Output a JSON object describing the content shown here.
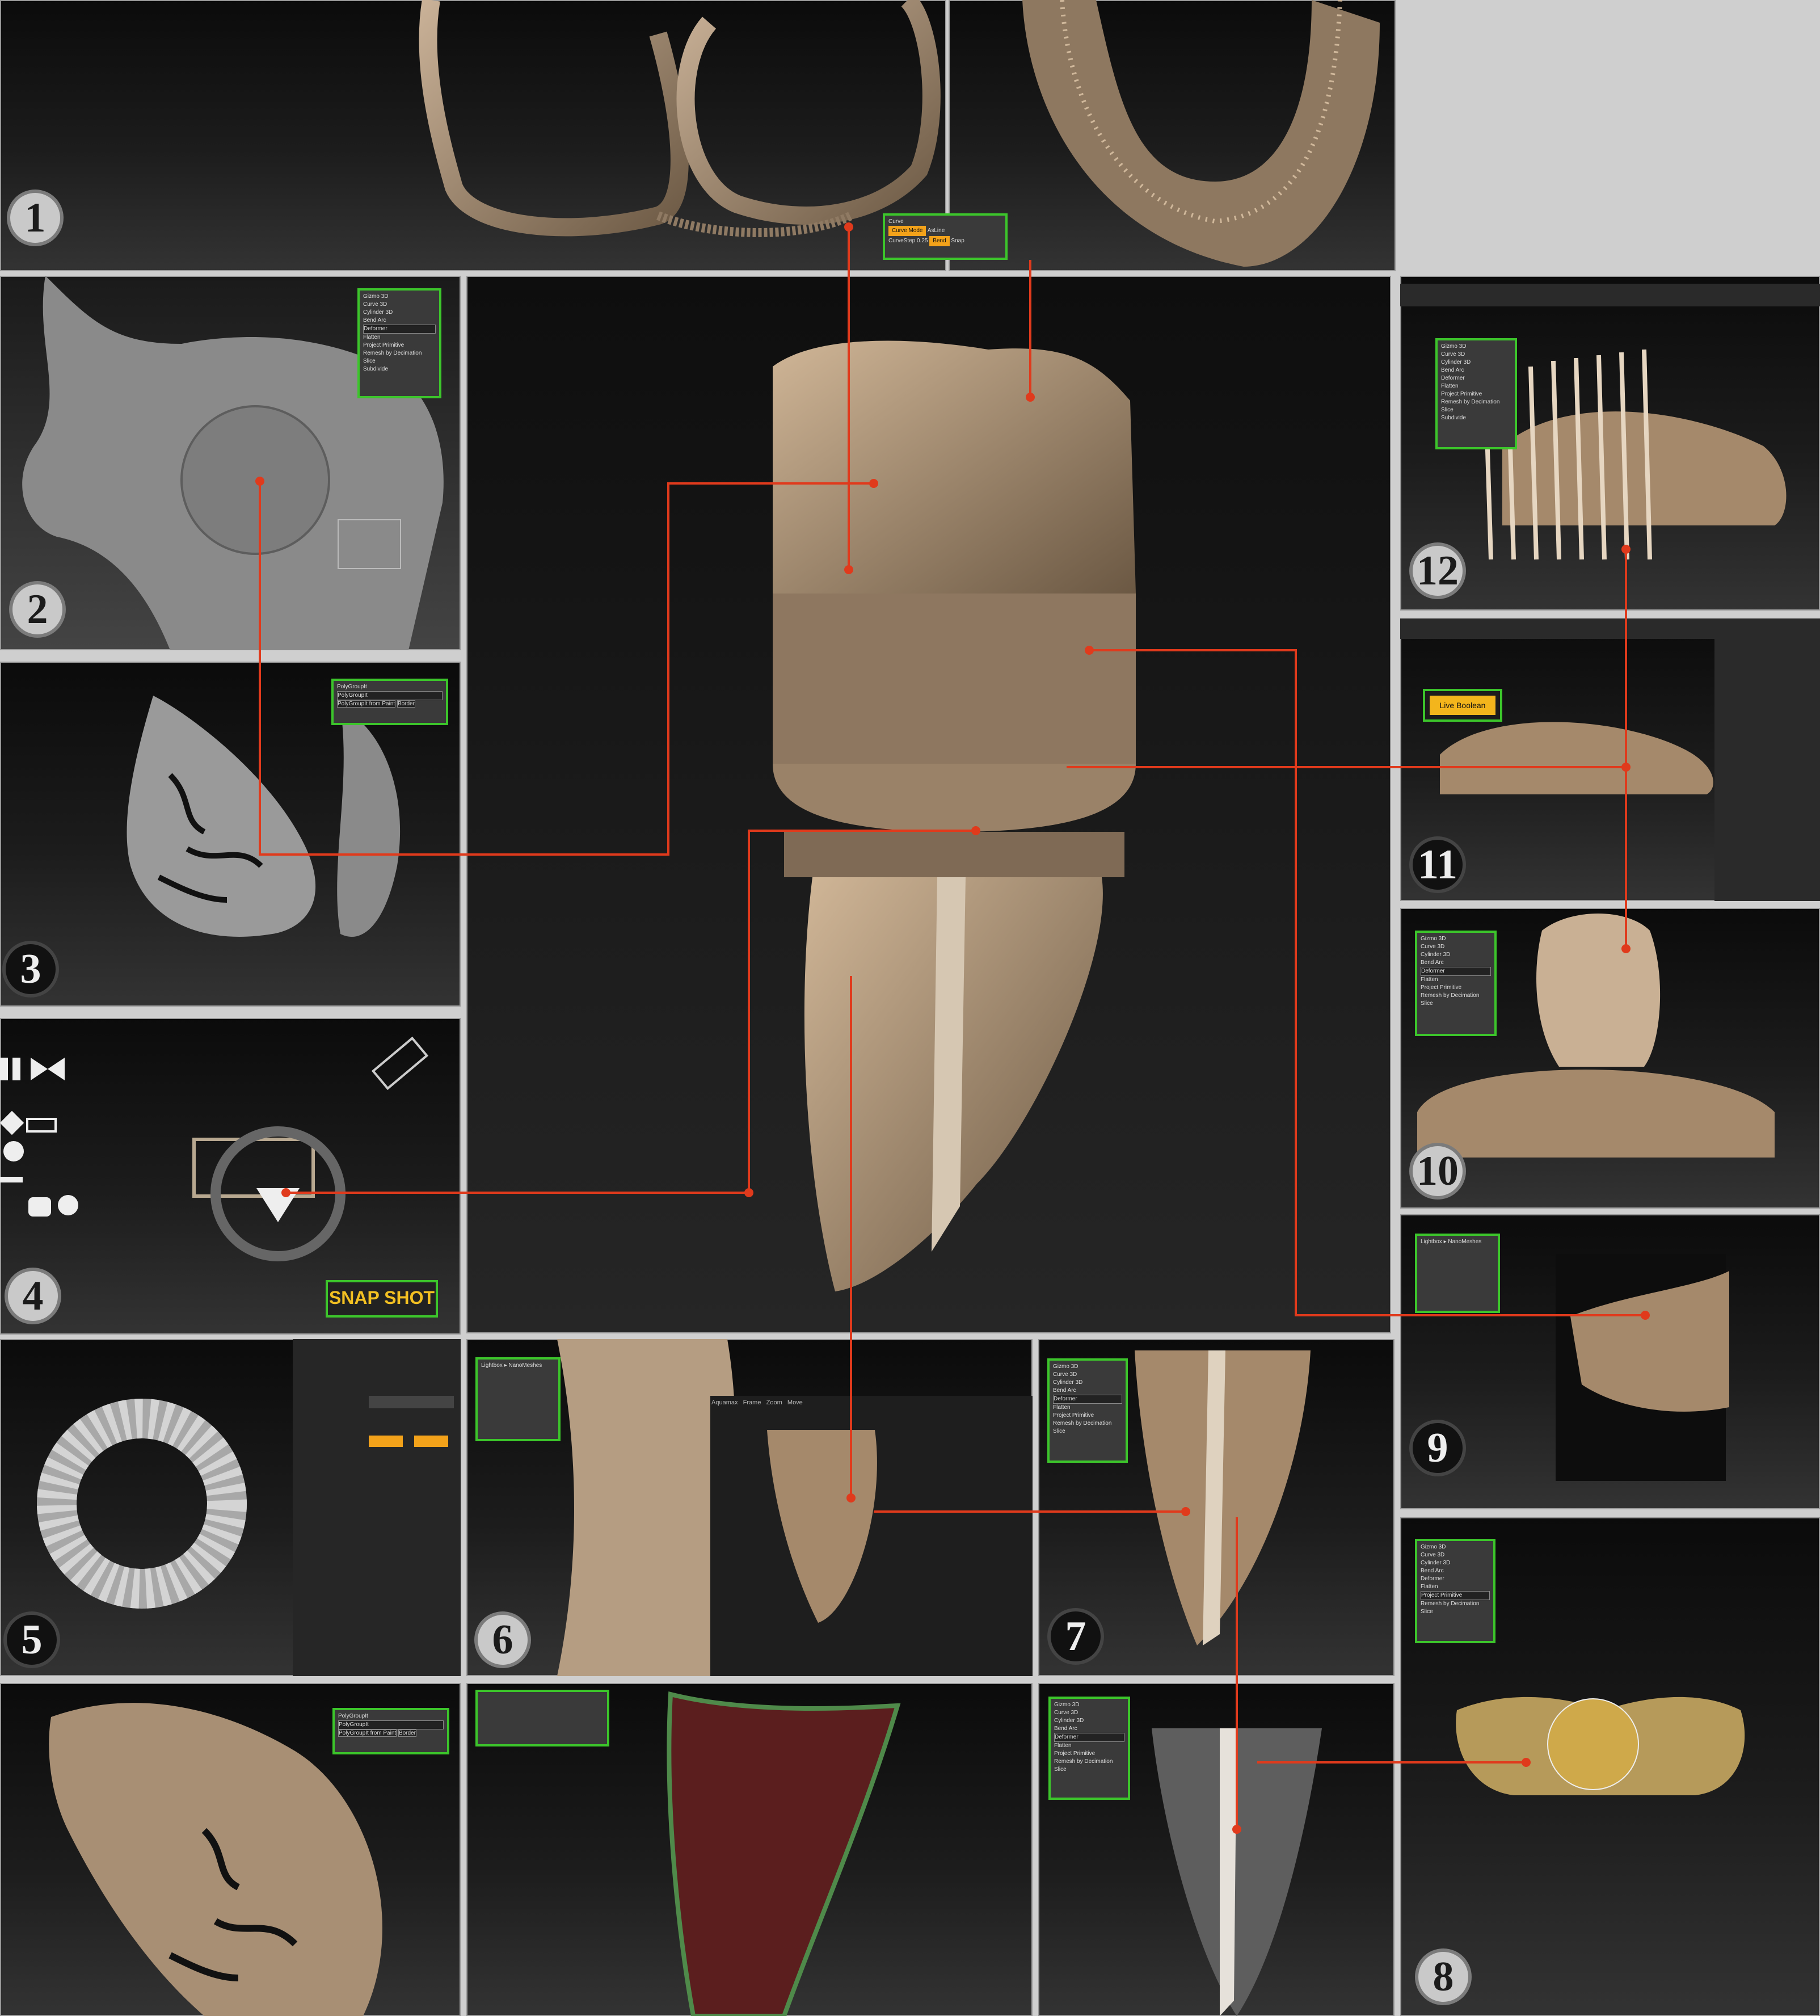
{
  "step_numbers": [
    "1",
    "2",
    "3",
    "4",
    "5",
    "6",
    "7",
    "8",
    "9",
    "10",
    "11",
    "12"
  ],
  "curve_menu": {
    "header": "Curve",
    "curve_mode": "Curve Mode",
    "as_line": "AsLine",
    "curve_step": "CurveStep 0.25",
    "bend": "Bend",
    "snap": "Snap"
  },
  "gizmo_menu": {
    "title": "Gizmo 3D",
    "icons": [
      "Curve 3D",
      "Cylinder 3D"
    ],
    "items": [
      "Bend Arc",
      "Deformer",
      "Flatten",
      "Project Primitive",
      "Remesh by Decimation",
      "Slice",
      "Subdivide"
    ]
  },
  "polygroup_menu": {
    "title": "PolyGroupIt",
    "button": "PolyGroupIt",
    "from_paint": "PolyGroupIt from Paint",
    "border": "Border"
  },
  "snapshot_label": "SNAP SHOT",
  "live_boolean_label": "Live Boolean",
  "mesh_panel": {
    "tabs": [
      "Aquamax",
      "Frame",
      "Zoom",
      "Move"
    ],
    "lightbox": "Lightbox ▸ NanoMeshes"
  },
  "accent_colors": {
    "green_frame": "#3cc52b",
    "orange_ui": "#f3a21a",
    "red_leader": "#e03a1c",
    "clay": "#a58a6c"
  }
}
